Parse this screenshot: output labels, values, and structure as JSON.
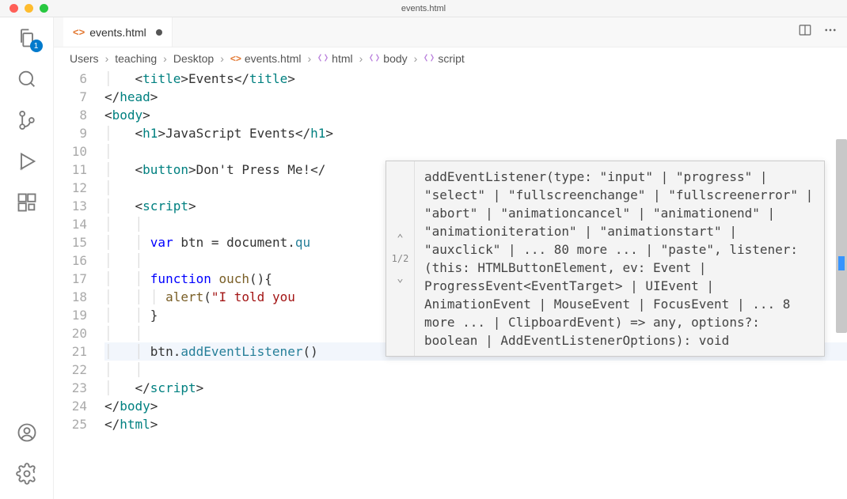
{
  "window": {
    "title": "events.html"
  },
  "activity": {
    "explorer_badge": "1"
  },
  "tab": {
    "icon_label": "<>",
    "name": "events.html"
  },
  "breadcrumb": {
    "parts": [
      "Users",
      "teaching",
      "Desktop"
    ],
    "file_icon": "<>",
    "file": "events.html",
    "sym_html": "html",
    "sym_body": "body",
    "sym_script": "script"
  },
  "gutter": {
    "start": 6,
    "end": 25
  },
  "code": {
    "l6": {
      "pre": "    ",
      "open": "<",
      "tag": "title",
      "gt": ">",
      "text": "Events",
      "close": "</",
      "tag2": "title",
      "gt2": ">"
    },
    "l7": {
      "pre": "  ",
      "close": "</",
      "tag": "head",
      "gt": ">"
    },
    "l8": {
      "pre": "  ",
      "open": "<",
      "tag": "body",
      "gt": ">"
    },
    "l9": {
      "pre": "    ",
      "open": "<",
      "tag": "h1",
      "gt": ">",
      "text": "JavaScript Events",
      "close": "</",
      "tag2": "h1",
      "gt2": ">"
    },
    "l10": {
      "pre": ""
    },
    "l11": {
      "pre": "    ",
      "open": "<",
      "tag": "button",
      "gt": ">",
      "text": "Don't Press Me!",
      "close": "</"
    },
    "l12": {
      "pre": ""
    },
    "l13": {
      "pre": "    ",
      "open": "<",
      "tag": "script",
      "gt": ">"
    },
    "l14": {
      "pre": ""
    },
    "l15": {
      "pre": "      ",
      "kw": "var",
      "sp": " ",
      "id": "btn = document.",
      "call": "qu"
    },
    "l16": {
      "pre": ""
    },
    "l17": {
      "pre": "      ",
      "kw": "function",
      "sp": " ",
      "fn": "ouch",
      "after": "(){"
    },
    "l18": {
      "pre": "        ",
      "fn": "alert",
      "paren": "(",
      "str": "\"I told you",
      "tail": ""
    },
    "l19": {
      "pre": "      ",
      "brace": "}"
    },
    "l20": {
      "pre": ""
    },
    "l21": {
      "pre": "      ",
      "obj": "btn.",
      "method": "addEventListener",
      "paren": "()"
    },
    "l22": {
      "pre": ""
    },
    "l23": {
      "pre": "    ",
      "close": "</",
      "tag": "script",
      "gt": ">"
    },
    "l24": {
      "pre": "  ",
      "close": "</",
      "tag": "body",
      "gt": ">"
    },
    "l25": {
      "pre": "  ",
      "close": "</",
      "tag": "html",
      "gt": ">"
    }
  },
  "tooltip": {
    "counter": "1/2",
    "text": "addEventListener(type: \"input\" | \"progress\" | \"select\" | \"fullscreenchange\" | \"fullscreenerror\" | \"abort\" | \"animationcancel\" | \"animationend\" | \"animationiteration\" | \"animationstart\" | \"auxclick\" | ... 80 more ... | \"paste\", listener: (this: HTMLButtonElement, ev: Event | ProgressEvent<EventTarget> | UIEvent | AnimationEvent | MouseEvent | FocusEvent | ... 8 more ... | ClipboardEvent) => any, options?: boolean | AddEventListenerOptions): void"
  }
}
